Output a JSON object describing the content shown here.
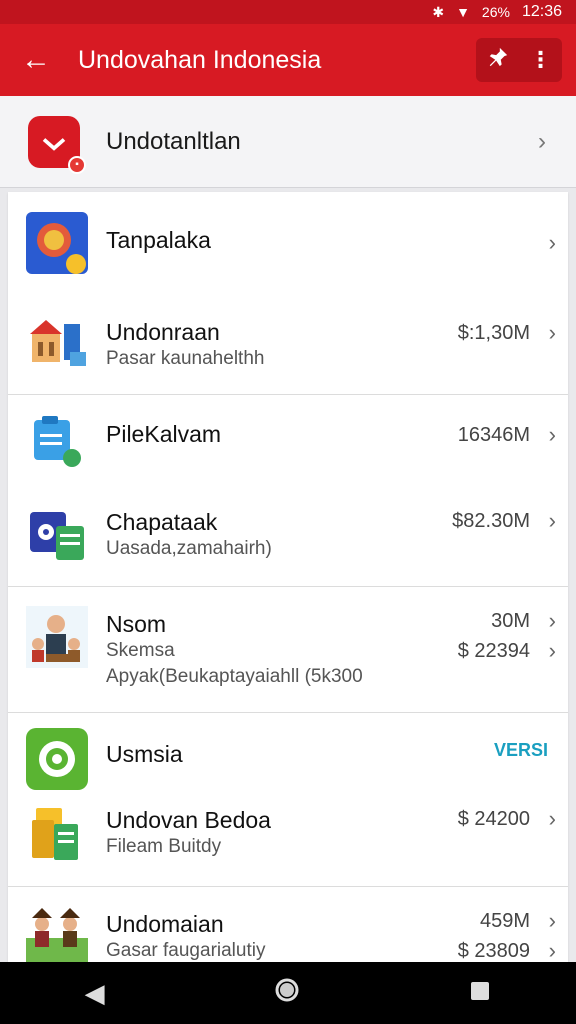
{
  "status": {
    "bluetooth_icon": "bluetooth-icon",
    "wifi_icon": "wifi-icon",
    "battery": "26%",
    "time": "12:36"
  },
  "app_bar": {
    "title": "Undovahan Indonesia",
    "back_icon": "arrow-left-icon",
    "pin_icon": "pin-icon",
    "more_icon": "more-vert-icon"
  },
  "header": {
    "label": "Undotanltlan",
    "icon": "app-logo-icon"
  },
  "items": [
    {
      "title": "Tanpalaka",
      "subtitle": "",
      "value": "",
      "icon": "emblem-icon"
    },
    {
      "title": "Undonraan",
      "subtitle": "Pasar kaunahelthh",
      "value": "$:1,30M",
      "icon": "building-icon"
    },
    {
      "title": "PileKalvam",
      "subtitle": "",
      "value": "16346M",
      "icon": "document-icon"
    },
    {
      "title": "Chapataak",
      "subtitle": "Uasada,zamahairh)",
      "value": "$82.30M",
      "icon": "folder-disk-icon"
    },
    {
      "title": "Nsom",
      "subtitle": "Skemsa",
      "subtitle2": "Apyak(Beukaptayaiahll (5k300",
      "value": "30M",
      "value2": "$ 22394",
      "icon": "people-icon"
    },
    {
      "title": "Usmsia",
      "subtitle": "",
      "value": "VERSI",
      "icon": "green-app-icon"
    },
    {
      "title": "Undovan Bedoa",
      "subtitle": "Fileam Buitdy",
      "value": "$ 24200",
      "icon": "files-icon"
    },
    {
      "title": "Undomaian",
      "subtitle": "Gasar faugarialutiy",
      "value": "459M",
      "value2": "$ 23809",
      "icon": "village-icon"
    }
  ],
  "nav": {
    "back": "back-triangle-icon",
    "home": "home-circle-icon",
    "recents": "recents-square-icon"
  },
  "colors": {
    "brand": "#d71a23",
    "accent_teal": "#1a9fc0"
  }
}
